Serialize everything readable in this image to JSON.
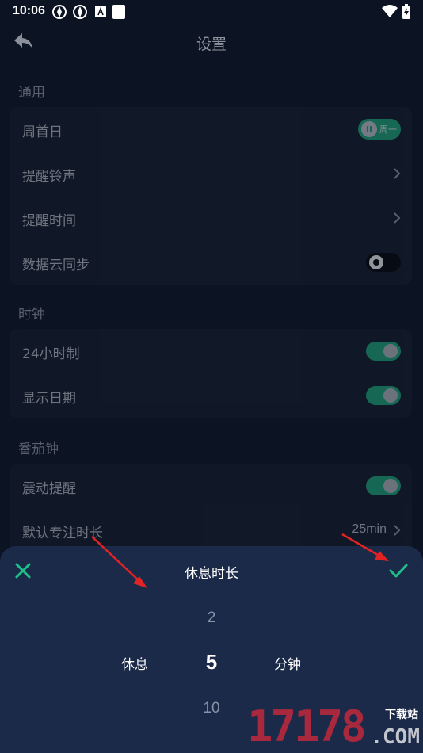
{
  "status_bar": {
    "time": "10:06"
  },
  "header": {
    "title": "设置"
  },
  "sections": {
    "general": {
      "title": "通用",
      "week_start": {
        "label": "周首日",
        "toggle_text": "周一"
      },
      "ringtone": {
        "label": "提醒铃声"
      },
      "reminder_time": {
        "label": "提醒时间"
      },
      "cloud_sync": {
        "label": "数据云同步",
        "enabled": false
      }
    },
    "clock": {
      "title": "时钟",
      "h24": {
        "label": "24小时制",
        "enabled": true
      },
      "show_date": {
        "label": "显示日期",
        "enabled": true
      }
    },
    "pomodoro": {
      "title": "番茄钟",
      "vibrate": {
        "label": "震动提醒",
        "enabled": true
      },
      "focus_duration": {
        "label": "默认专注时长",
        "value": "25min"
      }
    }
  },
  "sheet": {
    "title": "休息时长",
    "left_label": "休息",
    "right_label": "分钟",
    "prev_value": "2",
    "selected_value": "5",
    "next_value": "10"
  },
  "watermark": {
    "number": "17178",
    "site": "下载站",
    "domain": ".COM"
  },
  "colors": {
    "accent": "#1fae7d",
    "sheet_bg": "#1c2a4a",
    "page_bg": "#0c1322",
    "arrow": "#e02424"
  },
  "icons": [
    "back-arrow-icon",
    "chevron-right-icon",
    "close-icon",
    "check-icon"
  ]
}
